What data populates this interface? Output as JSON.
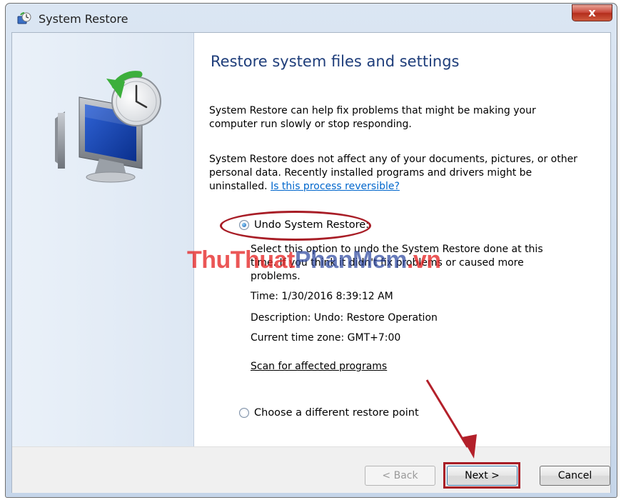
{
  "window": {
    "title": "System Restore",
    "close_label": "x"
  },
  "main": {
    "heading": "Restore system files and settings",
    "intro": "System Restore can help fix problems that might be making your computer run slowly or stop responding.",
    "info": "System Restore does not affect any of your documents, pictures, or other personal data. Recently installed programs and drivers might be uninstalled.",
    "reversible_link": "Is this process reversible?",
    "undo_option": {
      "label": "Undo System Restore:",
      "selected": true,
      "description": "Select this option to undo the System Restore done at this time. If you think it didn't fix problems or caused more problems.",
      "time": "Time: 1/30/2016 8:39:12 AM",
      "desc_label": "Description: Undo: Restore Operation",
      "timezone": "Current time zone: GMT+7:00",
      "scan_link": "Scan for affected programs"
    },
    "other_option": {
      "label": "Choose a different restore point",
      "selected": false
    }
  },
  "footer": {
    "back_label": "< Back",
    "next_label": "Next >",
    "cancel_label": "Cancel"
  },
  "watermark": {
    "part_a": "ThuThuat",
    "part_b": "PhanMem",
    "part_c": ".vn"
  },
  "colors": {
    "heading": "#1e3d7a",
    "link": "#0066cc",
    "annotation": "#a81d26"
  }
}
